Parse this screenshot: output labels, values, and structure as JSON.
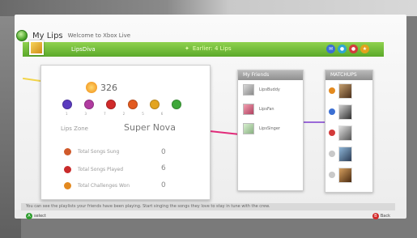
{
  "header": {
    "title": "My Lips",
    "subtitle": "Welcome to Xbox Live"
  },
  "bar": {
    "gamertag": "LipsDiva",
    "middle": "Earlier: 4 Lips"
  },
  "profile": {
    "gamerscore": "326",
    "rep_numbers": [
      "1",
      "3",
      "7",
      "2",
      "5",
      "6"
    ],
    "zone_label": "Lips Zone",
    "zone_value": "Super Nova",
    "stats": [
      {
        "label": "Total Songs Sung",
        "value": "0"
      },
      {
        "label": "Total Songs Played",
        "value": "6"
      },
      {
        "label": "Total Challenges Won",
        "value": "0"
      }
    ]
  },
  "friends": {
    "heading": "My Friends",
    "items": [
      "LipsBuddy",
      "LipsFan",
      "LipsSinger"
    ]
  },
  "matchups": {
    "heading": "MATCHUPS"
  },
  "bottom_text": "You can see the playlists your friends have been playing. Start singing the songs they love to stay in tune with the crew.",
  "footer": {
    "left": "select",
    "right": "Back"
  },
  "colors": {
    "accent": "#6fbf3a",
    "bar_top": "#8fd14e"
  }
}
